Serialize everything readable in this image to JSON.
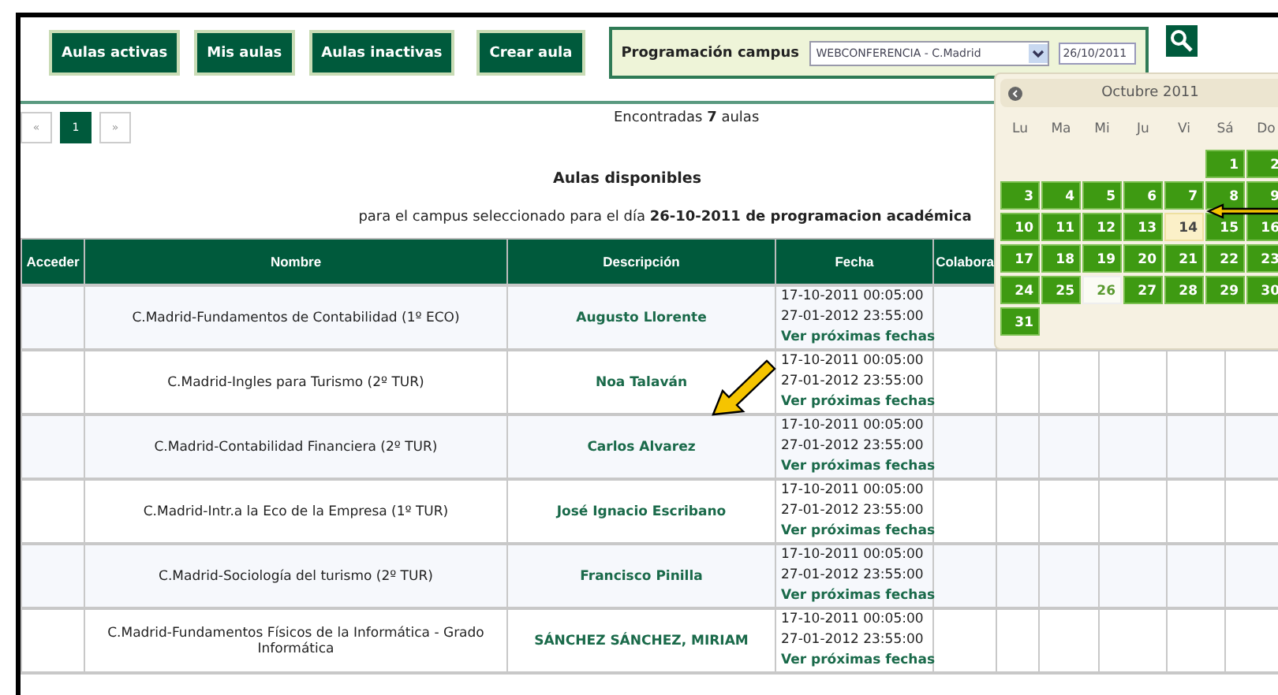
{
  "toolbar": {
    "buttons": [
      "Aulas activas",
      "Mis aulas",
      "Aulas inactivas",
      "Crear aula"
    ],
    "campus_label": "Programación campus",
    "campus_select": "WEBCONFERENCIA - C.Madrid",
    "date_field": "26/10/2011"
  },
  "pagination": {
    "prev": "«",
    "pages": [
      {
        "label": "1",
        "selected": true
      }
    ],
    "next": "»"
  },
  "found": "Encontradas **7** aulas",
  "heading": "Aulas disponibles",
  "subtitle": "para el campus seleccionado para el día **26-10-2011 de programacion académica**",
  "table": {
    "columns": [
      "Acceder",
      "Nombre",
      "Descripción",
      "Fecha",
      "Colabora"
    ],
    "rows": [
      {
        "nombre": "C.Madrid-Fundamentos de Contabilidad (1º ECO)",
        "descripcion": "Augusto Llorente",
        "inicio": "17-10-2011 00:05:00",
        "fin": "27-01-2012 23:55:00",
        "link": "Ver próximas fechas"
      },
      {
        "nombre": "C.Madrid-Ingles para Turismo (2º TUR)",
        "descripcion": "Noa Talaván",
        "inicio": "17-10-2011 00:05:00",
        "fin": "27-01-2012 23:55:00",
        "link": "Ver próximas fechas"
      },
      {
        "nombre": "C.Madrid-Contabilidad Financiera (2º TUR)",
        "descripcion": "Carlos Alvarez",
        "inicio": "17-10-2011 00:05:00",
        "fin": "27-01-2012 23:55:00",
        "link": "Ver próximas fechas"
      },
      {
        "nombre": "C.Madrid-Intr.a la Eco de la Empresa (1º TUR)",
        "descripcion": "José Ignacio Escribano",
        "inicio": "17-10-2011 00:05:00",
        "fin": "27-01-2012 23:55:00",
        "link": "Ver próximas fechas"
      },
      {
        "nombre": "C.Madrid-Sociología del turismo (2º TUR)",
        "descripcion": "Francisco Pinilla",
        "inicio": "17-10-2011 00:05:00",
        "fin": "27-01-2012 23:55:00",
        "link": "Ver próximas fechas"
      },
      {
        "nombre": "C.Madrid-Fundamentos Físicos de la Informática - Grado Informática",
        "descripcion": "SÁNCHEZ SÁNCHEZ, MIRIAM",
        "inicio": "17-10-2011 00:05:00",
        "fin": "27-01-2012 23:55:00",
        "link": "Ver próximas fechas"
      }
    ]
  },
  "calendar": {
    "title": "Octubre 2011",
    "weekdays": [
      "Lu",
      "Ma",
      "Mi",
      "Ju",
      "Vi",
      "Sá",
      "Do"
    ],
    "days": [
      {
        "label": "1",
        "selected": false,
        "today": false
      },
      {
        "label": "2",
        "selected": false,
        "today": false
      },
      {
        "label": "3",
        "selected": false,
        "today": false
      },
      {
        "label": "4",
        "selected": false,
        "today": false
      },
      {
        "label": "5",
        "selected": false,
        "today": false
      },
      {
        "label": "6",
        "selected": false,
        "today": false
      },
      {
        "label": "7",
        "selected": false,
        "today": false
      },
      {
        "label": "8",
        "selected": false,
        "today": false
      },
      {
        "label": "9",
        "selected": false,
        "today": false
      },
      {
        "label": "10",
        "selected": false,
        "today": false
      },
      {
        "label": "11",
        "selected": false,
        "today": false
      },
      {
        "label": "12",
        "selected": false,
        "today": false
      },
      {
        "label": "13",
        "selected": false,
        "today": false
      },
      {
        "label": "14",
        "selected": false,
        "today": true
      },
      {
        "label": "15",
        "selected": false,
        "today": false
      },
      {
        "label": "16",
        "selected": false,
        "today": false
      },
      {
        "label": "17",
        "selected": false,
        "today": false
      },
      {
        "label": "18",
        "selected": false,
        "today": false
      },
      {
        "label": "19",
        "selected": false,
        "today": false
      },
      {
        "label": "20",
        "selected": false,
        "today": false
      },
      {
        "label": "21",
        "selected": false,
        "today": false
      },
      {
        "label": "22",
        "selected": false,
        "today": false
      },
      {
        "label": "23",
        "selected": false,
        "today": false
      },
      {
        "label": "24",
        "selected": false,
        "today": false
      },
      {
        "label": "25",
        "selected": false,
        "today": false
      },
      {
        "label": "26",
        "selected": true,
        "today": false
      },
      {
        "label": "27",
        "selected": false,
        "today": false
      },
      {
        "label": "28",
        "selected": false,
        "today": false
      },
      {
        "label": "29",
        "selected": false,
        "today": false
      },
      {
        "label": "30",
        "selected": false,
        "today": false
      },
      {
        "label": "31",
        "selected": false,
        "today": false
      }
    ]
  }
}
